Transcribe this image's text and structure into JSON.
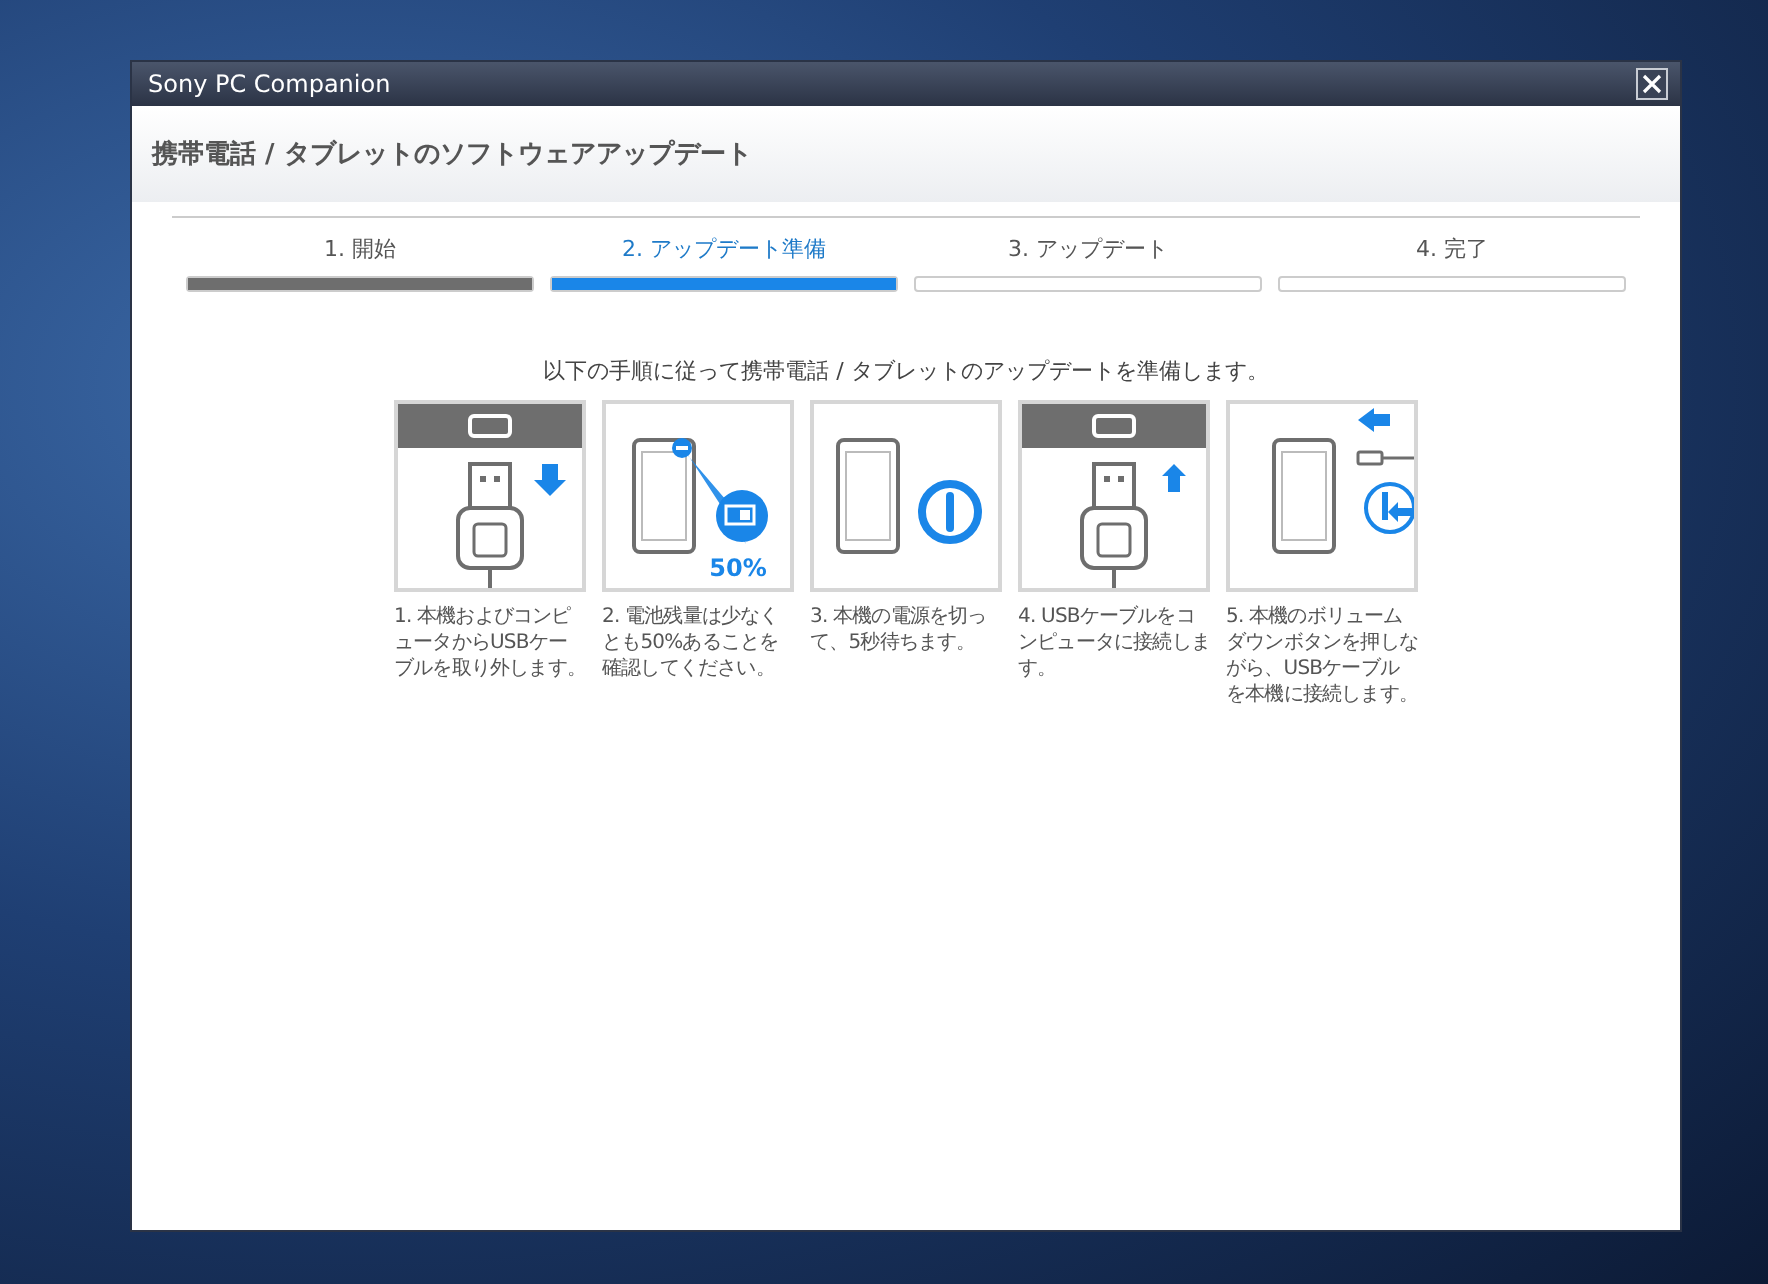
{
  "window": {
    "title": "Sony PC Companion"
  },
  "heading": "携帯電話 / タブレットのソフトウェアアップデート",
  "steps": [
    {
      "label": "1. 開始",
      "level": 1,
      "selected": false
    },
    {
      "label": "2. アップデート準備",
      "level": 1,
      "selected": true
    },
    {
      "label": "3. アップデート",
      "level": 0,
      "selected": false
    },
    {
      "label": "4. 完了",
      "level": 0,
      "selected": false
    }
  ],
  "instruction": "以下の手順に従って携帯電話 / タブレットのアップデートを準備します。",
  "cards": [
    {
      "kind": "unplug",
      "caption": "1. 本機およびコンピュータからUSBケーブルを取り外します。"
    },
    {
      "kind": "battery",
      "badge": "50%",
      "caption": "2. 電池残量は少なくとも50%あることを確認してください。"
    },
    {
      "kind": "power",
      "caption": "3. 本機の電源を切って、5秒待ちます。"
    },
    {
      "kind": "plug",
      "caption": "4. USBケーブルをコンピュータに接続します。"
    },
    {
      "kind": "volume",
      "caption": "5. 本機のボリュームダウンボタンを押しながら、USBケーブルを本機に接続します。"
    }
  ]
}
